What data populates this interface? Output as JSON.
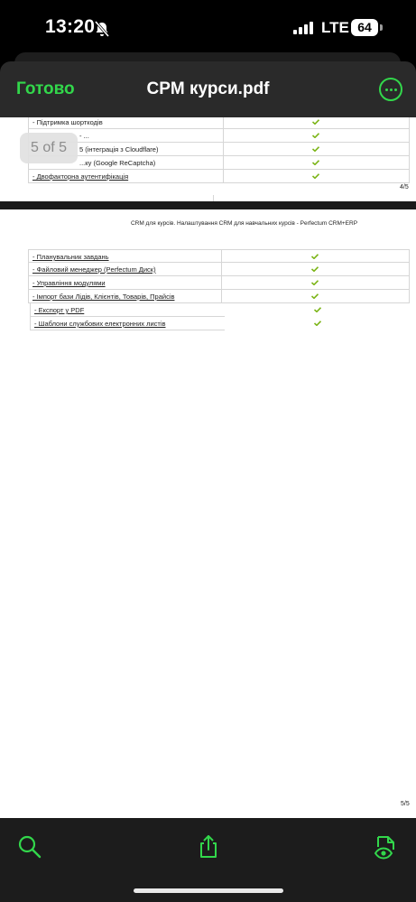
{
  "status_bar": {
    "time": "13:20",
    "network": "LTE",
    "battery": "64"
  },
  "nav": {
    "done_label": "Готово",
    "title": "CPM курси.pdf"
  },
  "page_indicator": "5 of 5",
  "page4": {
    "rows": [
      {
        "label": "- Підтримка шорткодів",
        "check": true
      },
      {
        "label": "- ...",
        "check": true
      },
      {
        "label": "5 (інтеграція з Cloudflare)",
        "check": true
      },
      {
        "label": "...ку (Google ReCaptcha)",
        "check": true
      },
      {
        "label": "- Двофакторна аутентифікація",
        "check": true
      }
    ],
    "page_number": "4/5"
  },
  "page5": {
    "heading": "CRM для курсів. Налаштування CRM для навчальних курсів - Perfectum CRM+ERP",
    "rows": [
      {
        "label": "- Планувальник завдань",
        "check": true
      },
      {
        "label": "- Файловий менеджер (Perfectum Диск)",
        "check": true
      },
      {
        "label": "- Управління модулями",
        "check": true
      },
      {
        "label": "- Імпорт бази Лідів, Клієнтів, Товарів, Прайсів",
        "check": true
      },
      {
        "label": "- Експорт у PDF",
        "check": true
      },
      {
        "label": "- Шаблони службових електронних листів",
        "check": true
      }
    ],
    "page_number": "5/5"
  },
  "toolbar": {
    "icons": [
      "search-icon",
      "share-icon",
      "page-view-icon"
    ]
  },
  "colors": {
    "accent": "#32d74b",
    "check": "#7cb518"
  }
}
